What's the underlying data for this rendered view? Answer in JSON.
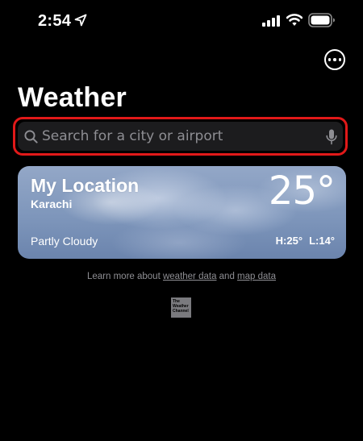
{
  "status_bar": {
    "time": "2:54",
    "icons": [
      "location-arrow-icon",
      "signal-icon",
      "wifi-icon",
      "battery-icon"
    ]
  },
  "header": {
    "title": "Weather",
    "more_icon": "ellipsis-circle-icon"
  },
  "search": {
    "placeholder": "Search for a city or airport",
    "value": "",
    "highlight_color": "#e11919"
  },
  "location_card": {
    "title": "My Location",
    "city": "Karachi",
    "temperature": "25°",
    "condition": "Partly Cloudy",
    "high": "H:25°",
    "low": "L:14°"
  },
  "footer": {
    "learn_more_prefix": "Learn more about ",
    "weather_data_link": "weather data",
    "conjunction": " and ",
    "map_data_link": "map data",
    "logo_lines": [
      "The",
      "Weather",
      "Channel"
    ]
  }
}
